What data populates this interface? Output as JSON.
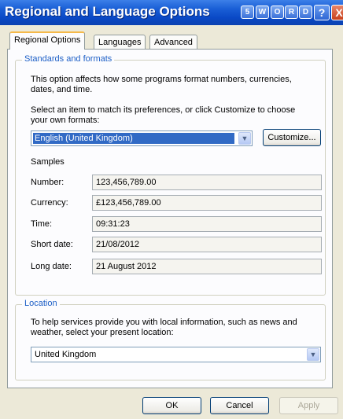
{
  "window": {
    "title": "Regional and Language Options",
    "badge_letters": [
      "5",
      "W",
      "O",
      "R",
      "D"
    ],
    "help_glyph": "?",
    "close_glyph": "X"
  },
  "tabs": [
    {
      "label": "Regional Options",
      "active": true
    },
    {
      "label": "Languages",
      "active": false
    },
    {
      "label": "Advanced",
      "active": false
    }
  ],
  "standards": {
    "group_title": "Standards and formats",
    "description": "This option affects how some programs format numbers, currencies, dates, and time.",
    "instruction": "Select an item to match its preferences, or click Customize to choose your own formats:",
    "selected_format": "English (United Kingdom)",
    "customize_label": "Customize...",
    "samples_heading": "Samples",
    "samples": [
      {
        "label": "Number:",
        "value": "123,456,789.00"
      },
      {
        "label": "Currency:",
        "value": "£123,456,789.00"
      },
      {
        "label": "Time:",
        "value": "09:31:23"
      },
      {
        "label": "Short date:",
        "value": "21/08/2012"
      },
      {
        "label": "Long date:",
        "value": "21 August 2012"
      }
    ]
  },
  "location": {
    "group_title": "Location",
    "description": "To help services provide you with local information, such as news and weather, select your present location:",
    "selected": "United Kingdom"
  },
  "buttons": {
    "ok": "OK",
    "cancel": "Cancel",
    "apply": "Apply"
  },
  "colors": {
    "titlebar": "#0a49c6",
    "group_title": "#1d5fc6",
    "selection": "#316ac5",
    "dialog_bg": "#ece9d8"
  },
  "icons": {
    "dropdown_arrow": "chevron-down-icon"
  }
}
